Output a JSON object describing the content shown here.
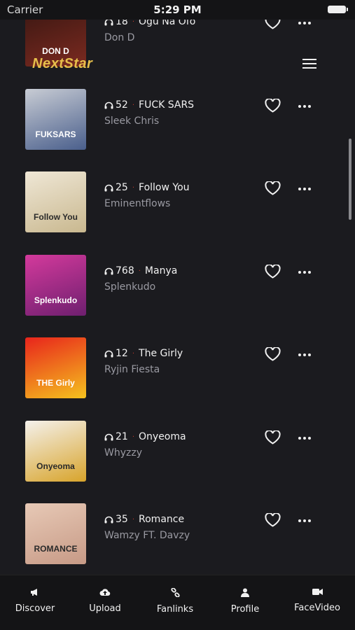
{
  "status_bar": {
    "carrier": "Carrier",
    "time": "5:29 PM"
  },
  "header": {
    "logo_text": "NextStar"
  },
  "tracks": [
    {
      "count": "18",
      "title": "Ogu Na Ofo",
      "artist": "Don D",
      "cover_text": "DON D",
      "cover_colors": [
        "#3a1712",
        "#7b2a20"
      ]
    },
    {
      "count": "52",
      "title": "FUCK SARS",
      "artist": "Sleek Chris",
      "cover_text": "FUKSARS",
      "cover_colors": [
        "#c8ccd4",
        "#4a5f8c"
      ]
    },
    {
      "count": "25",
      "title": "Follow You",
      "artist": "Eminentflows",
      "cover_text": "Follow You",
      "cover_colors": [
        "#efe7d6",
        "#c9b88f"
      ]
    },
    {
      "count": "768",
      "title": "Manya",
      "artist": "Splenkudo",
      "cover_text": "Splenkudo",
      "cover_colors": [
        "#d43a9c",
        "#6e1f6f"
      ]
    },
    {
      "count": "12",
      "title": "The Girly",
      "artist": "Ryjin Fiesta",
      "cover_text": "THE Girly",
      "cover_colors": [
        "#e8241c",
        "#f5c21e"
      ]
    },
    {
      "count": "21",
      "title": "Onyeoma",
      "artist": "Whyzzy",
      "cover_text": "Onyeoma",
      "cover_colors": [
        "#f4f1ec",
        "#d8a42b"
      ]
    },
    {
      "count": "35",
      "title": "Romance",
      "artist": "Wamzy FT. Davzy",
      "cover_text": "ROMANCE",
      "cover_colors": [
        "#e7c9b6",
        "#c79a86"
      ]
    }
  ],
  "tabs": [
    {
      "label": "Discover",
      "icon": "megaphone-icon"
    },
    {
      "label": "Upload",
      "icon": "cloud-upload-icon"
    },
    {
      "label": "Fanlinks",
      "icon": "link-icon"
    },
    {
      "label": "Profile",
      "icon": "user-icon"
    },
    {
      "label": "FaceVideo",
      "icon": "video-camera-icon"
    }
  ]
}
